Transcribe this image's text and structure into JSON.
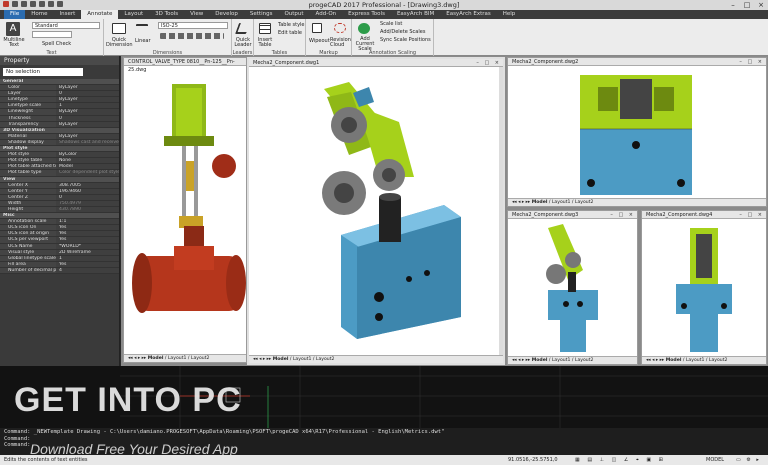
{
  "app": {
    "title": "progeCAD 2017 Professional - [Drawing3.dwg]"
  },
  "ribbon_tabs": [
    "File",
    "Home",
    "Insert",
    "Annotate",
    "Layout",
    "3D Tools",
    "View",
    "Develop",
    "Settings",
    "Output",
    "Add-On",
    "Express Tools",
    "EasyArch BIM",
    "EasyArch Extras",
    "Help"
  ],
  "active_tab": "Annotate",
  "ribbon": {
    "text_group": {
      "label": "Text",
      "multiline": "Multiline Text",
      "style_value": "Standard",
      "spell_check": "Spell Check"
    },
    "dimensions_group": {
      "label": "Dimensions",
      "quick": "Quick Dimension",
      "linear": "Linear",
      "style_value": "ISO-25"
    },
    "leaders_group": {
      "label": "Leaders",
      "quick_leader": "Quick Leader"
    },
    "tables_group": {
      "label": "Tables",
      "insert_table": "Insert Table",
      "table_style": "Table style",
      "edit_table": "Edit table"
    },
    "markup_group": {
      "label": "Markup",
      "wipeout": "Wipeout",
      "revision": "Revision Cloud"
    },
    "scaling_group": {
      "label": "Annotation Scaling",
      "add_current": "Add Current Scale",
      "scale_list": "Scale list",
      "add_delete": "Add/Delete Scales",
      "sync": "Sync Scale Positions"
    }
  },
  "properties": {
    "title": "Property",
    "selection": "No selection",
    "rows": [
      {
        "cat": "General"
      },
      {
        "k": "Color",
        "v": "ByLayer"
      },
      {
        "k": "Layer",
        "v": "0"
      },
      {
        "k": "Linetype",
        "v": "ByLayer"
      },
      {
        "k": "Linetype scale",
        "v": "1"
      },
      {
        "k": "Lineweight",
        "v": "ByLayer"
      },
      {
        "k": "Thickness",
        "v": "0"
      },
      {
        "k": "Transparency",
        "v": "ByLayer"
      },
      {
        "cat": "3D Visualization"
      },
      {
        "k": "Material",
        "v": "ByLayer"
      },
      {
        "k": "Shadow display",
        "v": "Shadows cast and receive",
        "dim": true
      },
      {
        "cat": "Plot style"
      },
      {
        "k": "Plot style",
        "v": "ByColor"
      },
      {
        "k": "Plot style table",
        "v": "None"
      },
      {
        "k": "Plot table attached to",
        "v": "Model"
      },
      {
        "k": "Plot table type",
        "v": "Color dependent plot style",
        "dim": true
      },
      {
        "cat": "View"
      },
      {
        "k": "Center X",
        "v": "308.7005"
      },
      {
        "k": "Center Y",
        "v": "196.9460"
      },
      {
        "k": "Center Z",
        "v": "0"
      },
      {
        "k": "Width",
        "v": "750.4979",
        "dim": true
      },
      {
        "k": "Height",
        "v": "430.7890",
        "dim": true
      },
      {
        "cat": "Misc"
      },
      {
        "k": "Annotation scale",
        "v": "1:1"
      },
      {
        "k": "UCS icon On",
        "v": "Yes"
      },
      {
        "k": "UCS icon at origin",
        "v": "Yes"
      },
      {
        "k": "UCS per viewport",
        "v": "Yes"
      },
      {
        "k": "UCS Name",
        "v": "*WORLD*"
      },
      {
        "k": "Visual style",
        "v": "2D Wireframe"
      },
      {
        "k": "Global linetype scale",
        "v": "1"
      },
      {
        "k": "Fill area",
        "v": "Yes"
      },
      {
        "k": "Number of decimal places",
        "v": "4"
      }
    ]
  },
  "viewports": [
    {
      "title": "CONTROL_VALVE_TYPE 0810__Pn-125__Pn-25.dwg"
    },
    {
      "title": "Mecha2_Component.dwg1"
    },
    {
      "title": "Mecha2_Component.dwg2"
    },
    {
      "title": "Mecha2_Component.dwg3"
    },
    {
      "title": "Mecha2_Component.dwg4"
    }
  ],
  "layout_tabs": {
    "model": "Model",
    "l1": "Layout1",
    "l2": "Layout2"
  },
  "command": {
    "line1": "Command:  _NEWTemplate Drawing - C:\\Users\\damiano.PROGESOFT\\AppData\\Roaming\\PSOFT\\progeCAD x64\\R17\\Professional - English\\Metrics.dwt\"",
    "line2": "Command:",
    "line3": "Command:"
  },
  "status": {
    "left": "Edits the contents of text entities",
    "coords": "91.0516,-25.5751,0",
    "model": "MODEL"
  },
  "watermark": {
    "main": "GET INTO PC",
    "sub": "Download Free Your Desired App"
  },
  "colors": {
    "part_green": "#a6d11b",
    "part_blue": "#4c9bc4",
    "part_grey": "#6c6c6c",
    "valve_red": "#b5361c"
  }
}
